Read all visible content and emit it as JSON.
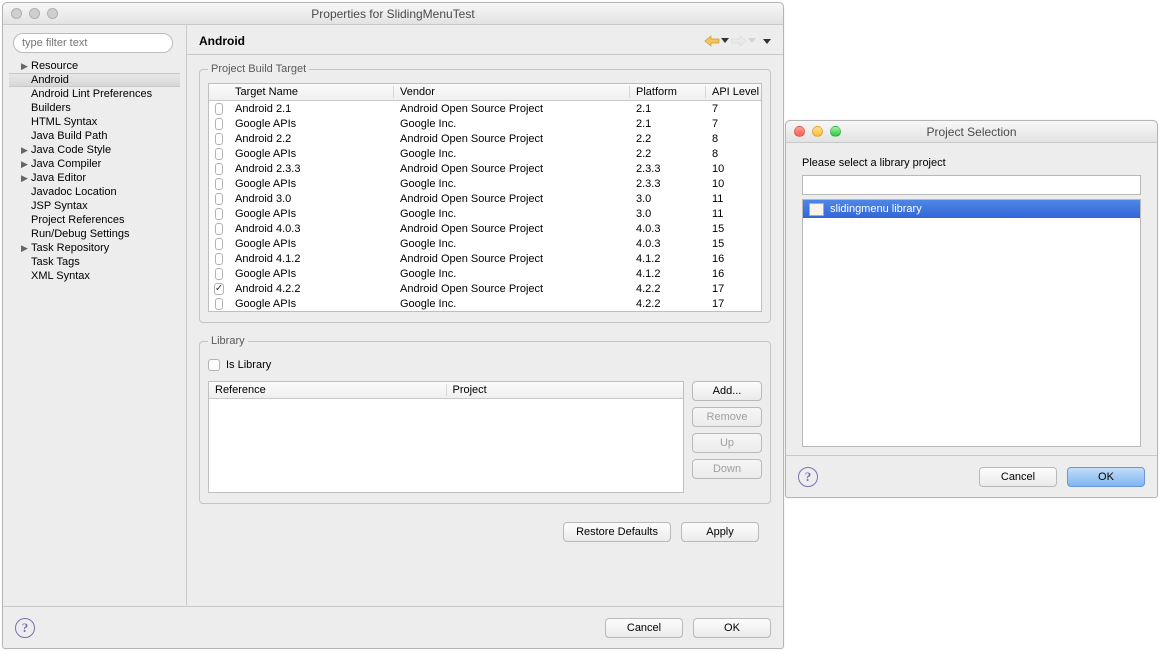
{
  "propWindow": {
    "title": "Properties for SlidingMenuTest",
    "filterPlaceholder": "type filter text",
    "tree": [
      {
        "label": "Resource",
        "expand": true
      },
      {
        "label": "Android",
        "selected": true,
        "indent": 1
      },
      {
        "label": "Android Lint Preferences",
        "indent": 1
      },
      {
        "label": "Builders",
        "indent": 1
      },
      {
        "label": "HTML Syntax",
        "indent": 1
      },
      {
        "label": "Java Build Path",
        "indent": 1
      },
      {
        "label": "Java Code Style",
        "expand": true,
        "indent": 1
      },
      {
        "label": "Java Compiler",
        "expand": true,
        "indent": 1
      },
      {
        "label": "Java Editor",
        "expand": true,
        "indent": 1
      },
      {
        "label": "Javadoc Location",
        "indent": 1
      },
      {
        "label": "JSP Syntax",
        "indent": 1
      },
      {
        "label": "Project References",
        "indent": 1
      },
      {
        "label": "Run/Debug Settings",
        "indent": 1
      },
      {
        "label": "Task Repository",
        "expand": true,
        "indent": 1
      },
      {
        "label": "Task Tags",
        "indent": 1
      },
      {
        "label": "XML Syntax",
        "indent": 1
      }
    ],
    "page": {
      "heading": "Android",
      "buildTargetLegend": "Project Build Target",
      "columns": {
        "name": "Target Name",
        "vendor": "Vendor",
        "platform": "Platform",
        "api": "API Level"
      },
      "targets": [
        {
          "name": "Android 2.1",
          "vendor": "Android Open Source Project",
          "platform": "2.1",
          "api": "7"
        },
        {
          "name": "Google APIs",
          "vendor": "Google Inc.",
          "platform": "2.1",
          "api": "7"
        },
        {
          "name": "Android 2.2",
          "vendor": "Android Open Source Project",
          "platform": "2.2",
          "api": "8"
        },
        {
          "name": "Google APIs",
          "vendor": "Google Inc.",
          "platform": "2.2",
          "api": "8"
        },
        {
          "name": "Android 2.3.3",
          "vendor": "Android Open Source Project",
          "platform": "2.3.3",
          "api": "10"
        },
        {
          "name": "Google APIs",
          "vendor": "Google Inc.",
          "platform": "2.3.3",
          "api": "10"
        },
        {
          "name": "Android 3.0",
          "vendor": "Android Open Source Project",
          "platform": "3.0",
          "api": "11"
        },
        {
          "name": "Google APIs",
          "vendor": "Google Inc.",
          "platform": "3.0",
          "api": "11"
        },
        {
          "name": "Android 4.0.3",
          "vendor": "Android Open Source Project",
          "platform": "4.0.3",
          "api": "15"
        },
        {
          "name": "Google APIs",
          "vendor": "Google Inc.",
          "platform": "4.0.3",
          "api": "15"
        },
        {
          "name": "Android 4.1.2",
          "vendor": "Android Open Source Project",
          "platform": "4.1.2",
          "api": "16"
        },
        {
          "name": "Google APIs",
          "vendor": "Google Inc.",
          "platform": "4.1.2",
          "api": "16"
        },
        {
          "name": "Android 4.2.2",
          "vendor": "Android Open Source Project",
          "platform": "4.2.2",
          "api": "17",
          "checked": true
        },
        {
          "name": "Google APIs",
          "vendor": "Google Inc.",
          "platform": "4.2.2",
          "api": "17"
        }
      ],
      "libraryLegend": "Library",
      "isLibraryLabel": "Is Library",
      "libColumns": {
        "ref": "Reference",
        "proj": "Project"
      },
      "btns": {
        "add": "Add...",
        "remove": "Remove",
        "up": "Up",
        "down": "Down"
      },
      "restore": "Restore Defaults",
      "apply": "Apply"
    },
    "bottom": {
      "cancel": "Cancel",
      "ok": "OK"
    }
  },
  "dlg2": {
    "title": "Project Selection",
    "prompt": "Please select a library project",
    "items": [
      "slidingmenu library"
    ],
    "cancel": "Cancel",
    "ok": "OK"
  }
}
